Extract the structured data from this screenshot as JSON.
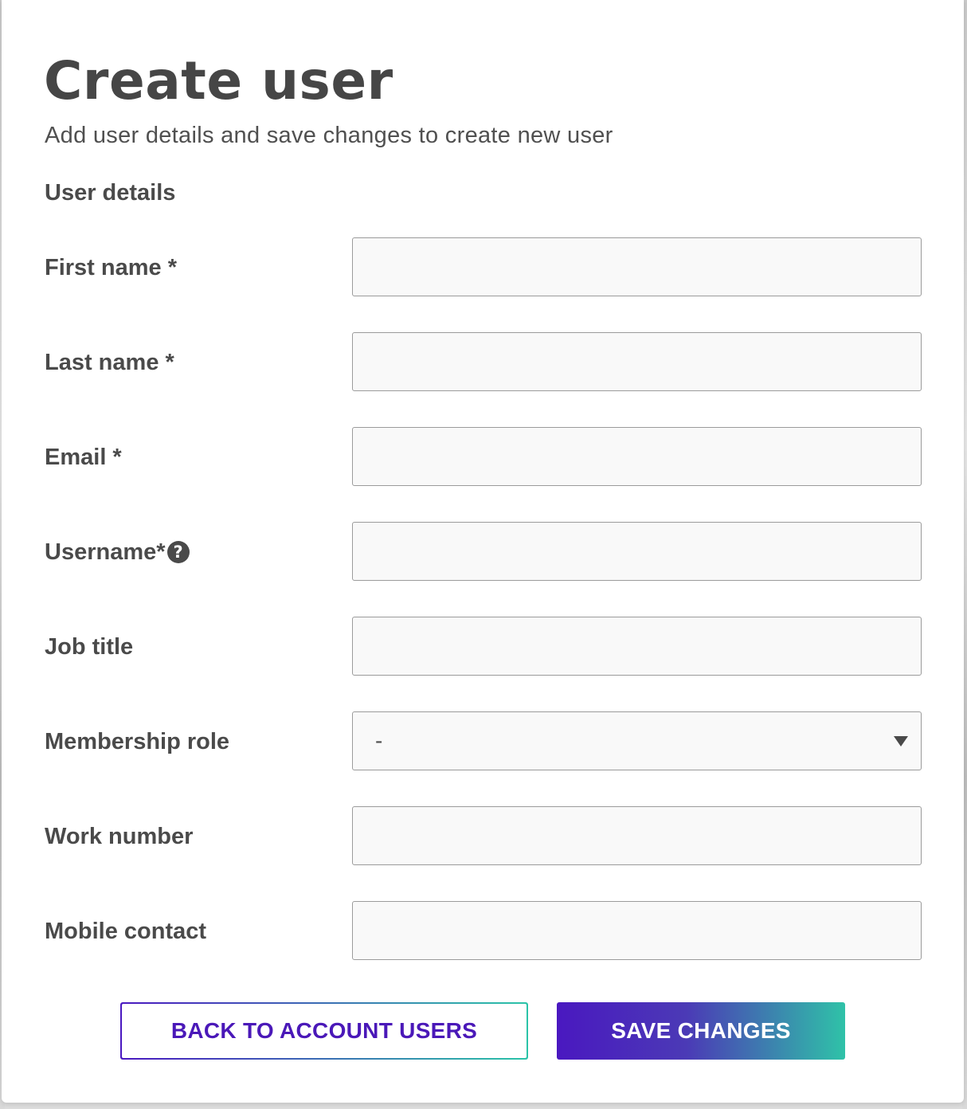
{
  "header": {
    "title": "Create user",
    "subtitle": "Add user details and save changes to create new user"
  },
  "section": {
    "heading": "User details"
  },
  "fields": {
    "first_name": {
      "label": "First name *",
      "value": ""
    },
    "last_name": {
      "label": "Last name *",
      "value": ""
    },
    "email": {
      "label": "Email *",
      "value": ""
    },
    "username": {
      "label": "Username*",
      "value": "",
      "help_icon": "question-circle-icon",
      "help_glyph": "?"
    },
    "job_title": {
      "label": "Job title",
      "value": ""
    },
    "membership_role": {
      "label": "Membership role",
      "selected": "-",
      "icon": "chevron-down-icon"
    },
    "work_number": {
      "label": "Work number",
      "value": ""
    },
    "mobile_contact": {
      "label": "Mobile contact",
      "value": ""
    }
  },
  "actions": {
    "back_label": "BACK TO ACCOUNT USERS",
    "save_label": "SAVE CHANGES"
  },
  "colors": {
    "text_dark": "#464646",
    "accent_purple": "#4a18c0",
    "accent_teal": "#2bc4a8",
    "input_border": "#9b9b9b",
    "input_bg": "#f9f9f9"
  }
}
